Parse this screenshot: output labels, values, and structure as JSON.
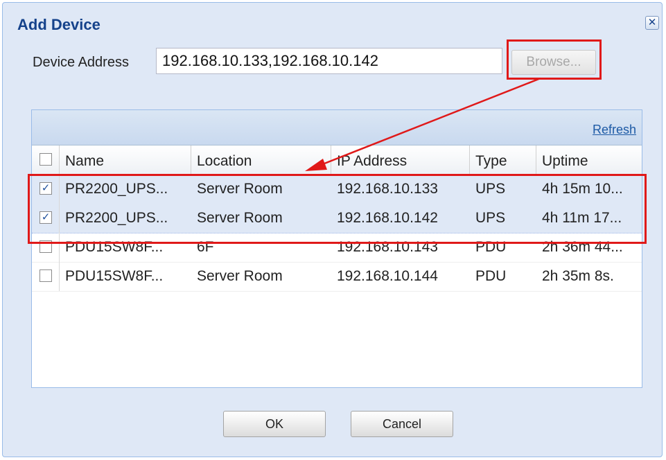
{
  "dialog": {
    "title": "Add Device",
    "close_glyph": "✕"
  },
  "address": {
    "label": "Device Address",
    "value": "192.168.10.133,192.168.10.142",
    "browse_label": "Browse..."
  },
  "grid": {
    "refresh_label": "Refresh",
    "columns": [
      "Name",
      "Location",
      "IP Address",
      "Type",
      "Uptime"
    ],
    "rows": [
      {
        "checked": true,
        "name": "PR2200_UPS...",
        "location": "Server Room",
        "ip": "192.168.10.133",
        "type": "UPS",
        "uptime": "4h 15m 10..."
      },
      {
        "checked": true,
        "name": "PR2200_UPS...",
        "location": "Server Room",
        "ip": "192.168.10.142",
        "type": "UPS",
        "uptime": "4h 11m 17..."
      },
      {
        "checked": false,
        "name": "PDU15SW8F...",
        "location": "6F",
        "ip": "192.168.10.143",
        "type": "PDU",
        "uptime": "2h 36m 44..."
      },
      {
        "checked": false,
        "name": "PDU15SW8F...",
        "location": "Server Room",
        "ip": "192.168.10.144",
        "type": "PDU",
        "uptime": "2h 35m 8s."
      }
    ]
  },
  "buttons": {
    "ok_label": "OK",
    "cancel_label": "Cancel"
  },
  "colors": {
    "highlight": "#e01919",
    "dialog_bg": "#dfe8f6",
    "title": "#15428b"
  }
}
